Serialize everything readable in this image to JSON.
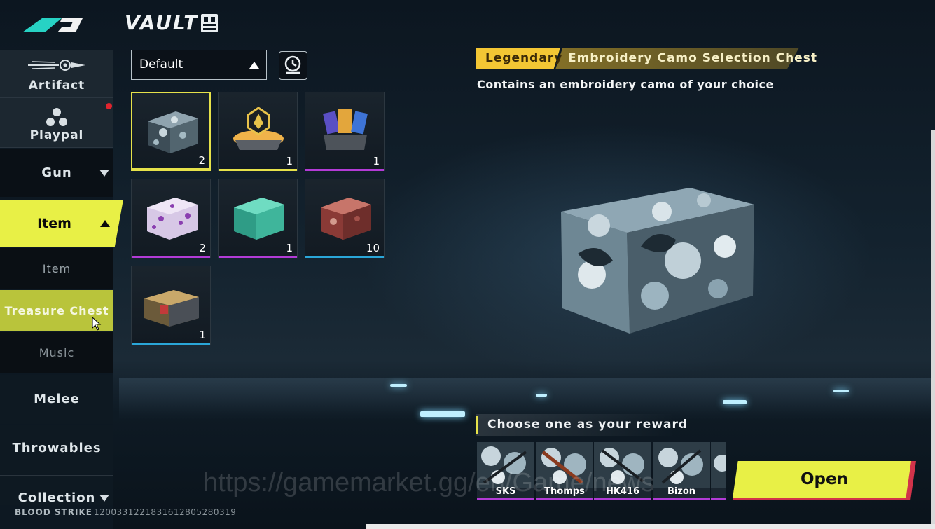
{
  "app": {
    "title": "VAULT",
    "logo": "blood-strike-logo",
    "vault_icon": "locker-icon"
  },
  "sidebar": {
    "artifact": "Artifact",
    "playpal": "Playpal",
    "playpal_badge_color": "#e0242e",
    "gun": "Gun",
    "item": "Item",
    "sub_item": "Item",
    "treasure_chest": "Treasure Chest",
    "music": "Music",
    "melee": "Melee",
    "throwables": "Throwables",
    "collection": "Collection"
  },
  "filter": {
    "dropdown_value": "Default",
    "history_icon": "clock-history-icon"
  },
  "inventory": [
    {
      "name": "embroidery-camo-chest",
      "qty": "2",
      "rarity_color": "#e6e24a",
      "selected": true
    },
    {
      "name": "golden-emblem-chest",
      "qty": "1",
      "rarity_color": "#e6e24a"
    },
    {
      "name": "character-card-chest",
      "qty": "1",
      "rarity_color": "#b23bd6"
    },
    {
      "name": "purple-splatter-chest",
      "qty": "2",
      "rarity_color": "#b23bd6"
    },
    {
      "name": "teal-chest",
      "qty": "1",
      "rarity_color": "#b23bd6"
    },
    {
      "name": "red-camo-chest",
      "qty": "10",
      "rarity_color": "#2aa6d8"
    },
    {
      "name": "gold-supply-chest",
      "qty": "1",
      "rarity_color": "#2aa6d8"
    }
  ],
  "details": {
    "rarity": "Legendary",
    "name": "Embroidery Camo Selection Chest",
    "description": "Contains an embroidery camo of your choice",
    "reward_header": "Choose one as your reward",
    "rewards": [
      "SKS",
      "Thomps",
      "HK416",
      "Bizon"
    ],
    "open_label": "Open"
  },
  "footer": {
    "brand": "BLOOD STRIKE",
    "id": "1200331221831612805280319"
  },
  "watermark": "https://gamemarket.gg/en/Game/news",
  "colors": {
    "accent": "#e8f046",
    "legendary": "#f3c634",
    "epic": "#b23bd6",
    "rare": "#2aa6d8"
  }
}
